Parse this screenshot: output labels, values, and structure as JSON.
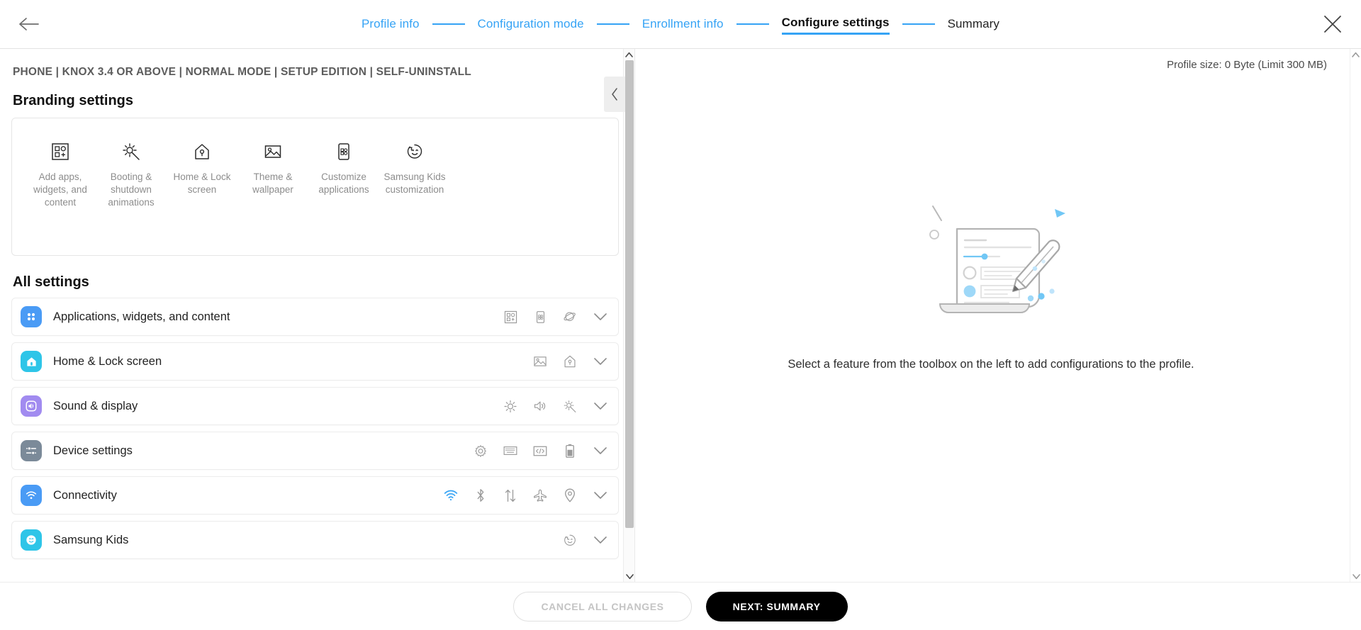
{
  "topbar": {
    "back_icon": "arrow-left-icon",
    "close_icon": "close-icon",
    "steps": [
      {
        "label": "Profile info",
        "state": "done"
      },
      {
        "label": "Configuration mode",
        "state": "done"
      },
      {
        "label": "Enrollment info",
        "state": "done"
      },
      {
        "label": "Configure settings",
        "state": "current"
      },
      {
        "label": "Summary",
        "state": "upcoming"
      }
    ]
  },
  "left": {
    "breadcrumb": "PHONE | KNOX 3.4 OR ABOVE | NORMAL MODE | SETUP EDITION | SELF-UNINSTALL",
    "branding_title": "Branding settings",
    "branding_items": [
      {
        "label": "Add apps, widgets, and content",
        "icon": "add-apps-widgets-icon"
      },
      {
        "label": "Booting & shutdown animations",
        "icon": "boot-animation-icon"
      },
      {
        "label": "Home & Lock screen",
        "icon": "home-lock-screen-icon"
      },
      {
        "label": "Theme & wallpaper",
        "icon": "image-wallpaper-icon"
      },
      {
        "label": "Customize applications",
        "icon": "customize-apps-icon"
      },
      {
        "label": "Samsung Kids customization",
        "icon": "samsung-kids-icon"
      }
    ],
    "all_settings_title": "All settings",
    "rows": [
      {
        "label": "Applications, widgets, and content",
        "badge_icon": "apps-grid-icon",
        "badge_color": "#4a9bf5",
        "icons": [
          "add-apps-widgets-icon",
          "customize-apps-icon",
          "knox-planet-icon"
        ]
      },
      {
        "label": "Home & Lock screen",
        "badge_icon": "home-icon",
        "badge_color": "#2ec5e8",
        "icons": [
          "image-wallpaper-icon",
          "home-lock-screen-icon"
        ]
      },
      {
        "label": "Sound & display",
        "badge_icon": "speaker-icon",
        "badge_color": "#a18bf0",
        "icons": [
          "brightness-icon",
          "volume-icon",
          "boot-animation-icon"
        ]
      },
      {
        "label": "Device settings",
        "badge_icon": "sliders-icon",
        "badge_color": "#7b8a99",
        "icons": [
          "gear-icon",
          "keyboard-icon",
          "code-icon",
          "battery-icon"
        ]
      },
      {
        "label": "Connectivity",
        "badge_icon": "wifi-icon",
        "badge_color": "#4a9bf5",
        "icons": [
          "wifi-icon",
          "bluetooth-icon",
          "data-transfer-icon",
          "airplane-icon",
          "location-pin-icon"
        ]
      },
      {
        "label": "Samsung Kids",
        "badge_icon": "samsung-kids-face-icon",
        "badge_color": "#2ec5e8",
        "icons": [
          "samsung-kids-face-icon"
        ]
      }
    ],
    "collapse_icon": "chevron-left-icon",
    "scroll_up_icon": "chevron-up-icon",
    "scroll_down_icon": "chevron-down-icon"
  },
  "right": {
    "profile_size": "Profile size: 0 Byte (Limit 300 MB)",
    "empty_illustration": "document-pencil-illustration",
    "empty_text": "Select a feature from the toolbox on the left to add configurations to the profile.",
    "scroll_up_icon": "chevron-up-icon",
    "scroll_down_icon": "chevron-down-icon"
  },
  "footer": {
    "cancel_label": "CANCEL ALL CHANGES",
    "next_label": "NEXT: SUMMARY"
  },
  "colors": {
    "accent": "#35a3f5",
    "illustration_blue": "#71c7f5",
    "text_primary": "#222222",
    "text_muted": "#8d8d8d"
  }
}
